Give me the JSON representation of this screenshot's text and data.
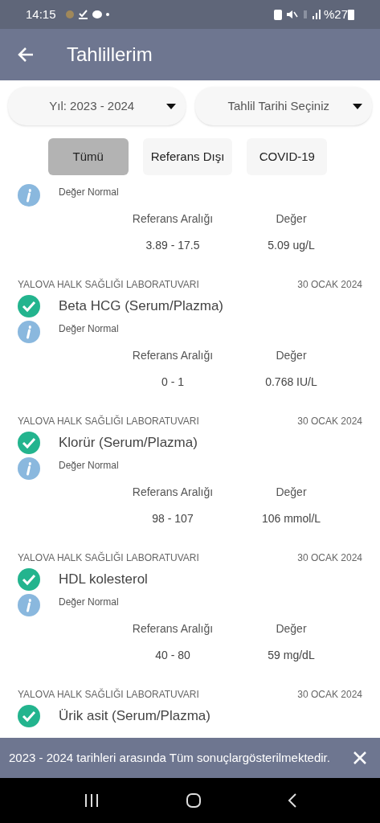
{
  "status_bar": {
    "time": "14:15",
    "battery": "%27"
  },
  "app_bar": {
    "title": "Tahlillerim"
  },
  "filters": [
    {
      "label": "Yıl: 2023 - 2024",
      "kind": "dropdown"
    },
    {
      "label": "Tahlil Tarihi Seçiniz",
      "kind": "dropdown"
    }
  ],
  "chips": [
    {
      "label": "Tümü",
      "selected": true
    },
    {
      "label": "Referans Dışı",
      "selected": false
    },
    {
      "label": "COVID-19",
      "selected": false
    }
  ],
  "results": [
    {
      "status": "Değer Normal",
      "range_label": "Referans Aralığı",
      "value_label": "Değer",
      "range": "3.89 - 17.5",
      "value": "5.09 ug/L"
    },
    {
      "lab": "YALOVA HALK SAĞLIĞI LABORATUVARI",
      "date": "30 OCAK 2024",
      "name": "Beta HCG (Serum/Plazma)",
      "normal": true,
      "status": "Değer Normal",
      "range_label": "Referans Aralığı",
      "value_label": "Değer",
      "range": "0 - 1",
      "value": "0.768 IU/L"
    },
    {
      "lab": "YALOVA HALK SAĞLIĞI LABORATUVARI",
      "date": "30 OCAK 2024",
      "name": "Klorür (Serum/Plazma)",
      "normal": true,
      "status": "Değer Normal",
      "range_label": "Referans Aralığı",
      "value_label": "Değer",
      "range": "98 - 107",
      "value": "106 mmol/L"
    },
    {
      "lab": "YALOVA HALK SAĞLIĞI LABORATUVARI",
      "date": "30 OCAK 2024",
      "name": "HDL kolesterol",
      "normal": true,
      "status": "Değer Normal",
      "range_label": "Referans Aralığı",
      "value_label": "Değer",
      "range": "40 - 80",
      "value": "59 mg/dL"
    },
    {
      "lab": "YALOVA HALK SAĞLIĞI LABORATUVARI",
      "date": "30 OCAK 2024",
      "name": "Ürik asit (Serum/Plazma)",
      "normal": true
    }
  ],
  "snackbar": {
    "message": "2023 - 2024 tarihleri arasında Tüm sonuçlargösterilmektedir."
  }
}
